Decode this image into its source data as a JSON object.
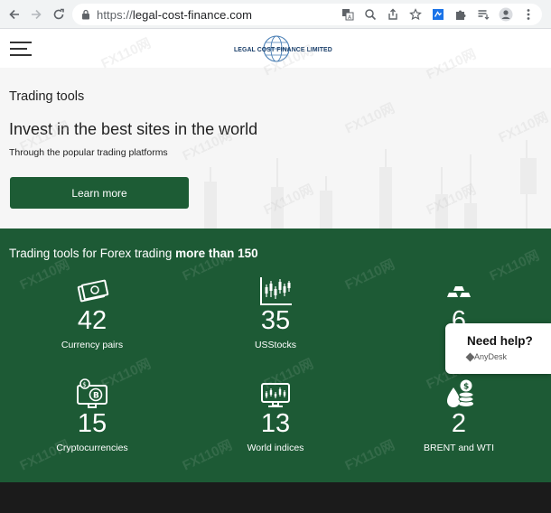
{
  "browser": {
    "url_scheme": "https://",
    "url_host": "legal-cost-finance.com",
    "nav": {
      "back_icon": "arrow-left-icon",
      "forward_icon": "arrow-right-icon",
      "reload_icon": "reload-icon"
    },
    "omnibox_icons": [
      "translate-icon",
      "zoom-icon",
      "share-icon",
      "bookmark-star-icon",
      "extension-icon",
      "puzzle-icon",
      "reading-list-icon",
      "profile-icon",
      "menu-dots-icon"
    ]
  },
  "header": {
    "logo_text": "LEGAL COST FINANCE LIMITED"
  },
  "hero": {
    "eyebrow": "Trading tools",
    "title": "Invest in the best sites in the world",
    "subtitle": "Through the popular trading platforms",
    "cta_label": "Learn more"
  },
  "stats": {
    "title_prefix": "Trading tools for Forex trading",
    "title_bold": "more than 150",
    "items": [
      {
        "value": "42",
        "label": "Currency pairs",
        "icon": "money-icon"
      },
      {
        "value": "35",
        "label": "USStocks",
        "icon": "candlestick-chart-icon"
      },
      {
        "value": "6",
        "label": "Gold",
        "icon": "gold-bars-icon"
      },
      {
        "value": "15",
        "label": "Cryptocurrencies",
        "icon": "crypto-screen-icon"
      },
      {
        "value": "13",
        "label": "World indices",
        "icon": "indices-screen-icon"
      },
      {
        "value": "2",
        "label": "BRENT and WTI",
        "icon": "oil-coins-icon"
      }
    ]
  },
  "help_widget": {
    "title": "Need help?",
    "subtitle": "AnyDesk"
  },
  "watermark": "FX110网",
  "colors": {
    "brand_green": "#1d5a35",
    "button_green": "#1d5c35",
    "dark_band": "#1b1b1b"
  }
}
